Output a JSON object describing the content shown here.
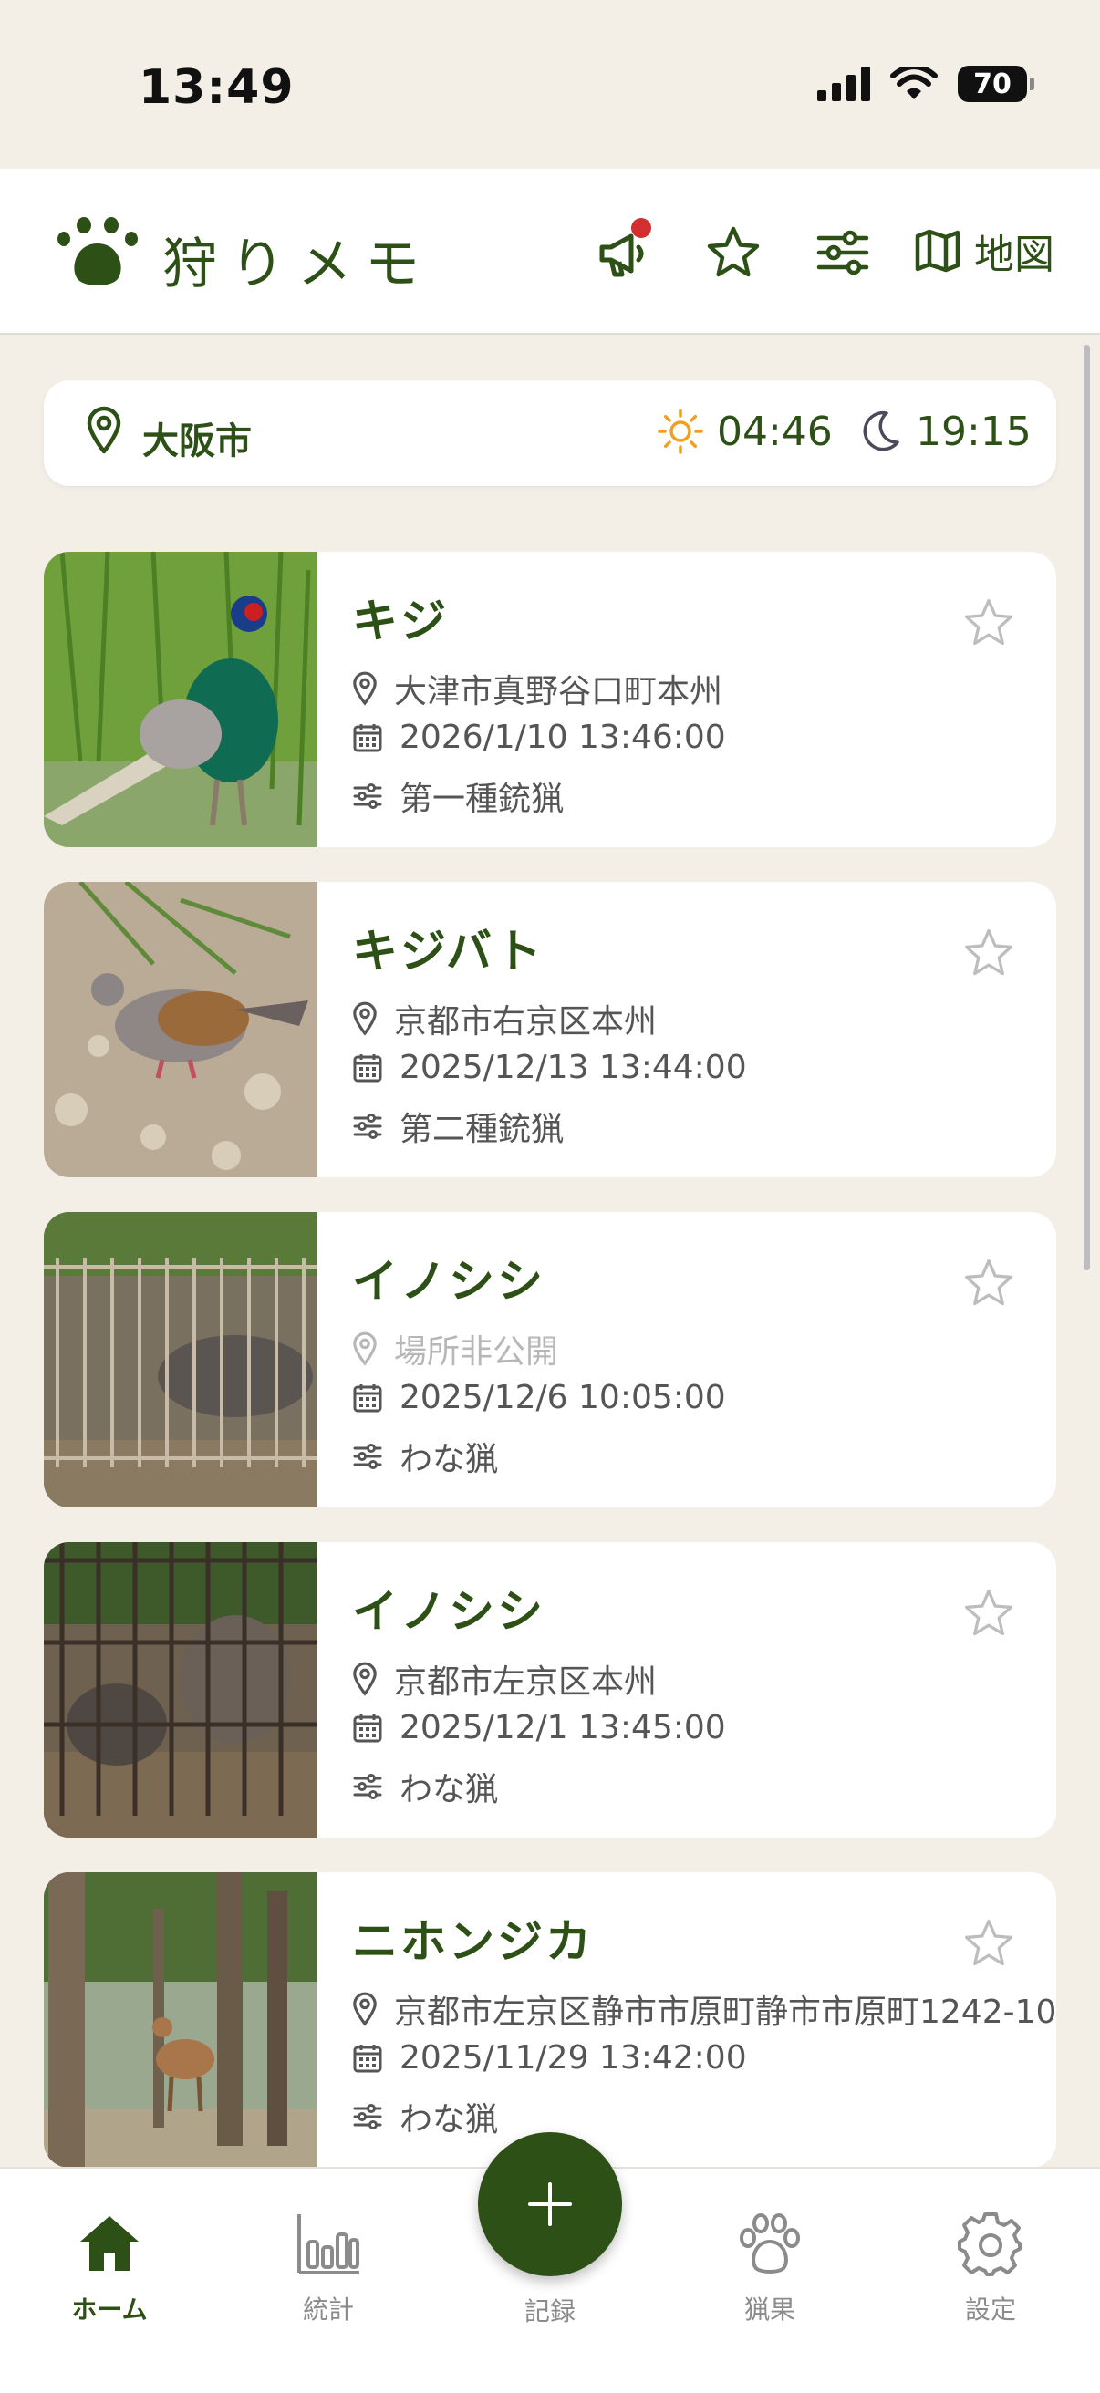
{
  "status_bar": {
    "time": "13:49",
    "battery": "70"
  },
  "header": {
    "title": "狩りメモ",
    "map_label": "地図"
  },
  "location_bar": {
    "city": "大阪市",
    "sunrise": "04:46",
    "sunset": "19:15"
  },
  "records": [
    {
      "name": "キジ",
      "location": "大津市真野谷口町本州",
      "datetime": "2026/1/10 13:46:00",
      "method": "第一種銃猟",
      "location_hidden": false
    },
    {
      "name": "キジバト",
      "location": "京都市右京区本州",
      "datetime": "2025/12/13 13:44:00",
      "method": "第二種銃猟",
      "location_hidden": false
    },
    {
      "name": "イノシシ",
      "location": "場所非公開",
      "datetime": "2025/12/6 10:05:00",
      "method": "わな猟",
      "location_hidden": true
    },
    {
      "name": "イノシシ",
      "location": "京都市左京区本州",
      "datetime": "2025/12/1 13:45:00",
      "method": "わな猟",
      "location_hidden": false
    },
    {
      "name": "ニホンジカ",
      "location": "京都市左京区静市市原町静市市原町1242-10",
      "datetime": "2025/11/29 13:42:00",
      "method": "わな猟",
      "location_hidden": false
    }
  ],
  "bottom_nav": {
    "home": "ホーム",
    "stats": "統計",
    "record": "記録",
    "game": "猟果",
    "settings": "設定"
  },
  "colors": {
    "primary": "#2d5016",
    "background": "#f3efe7",
    "notification": "#d32f2f",
    "sun": "#f0a020"
  }
}
